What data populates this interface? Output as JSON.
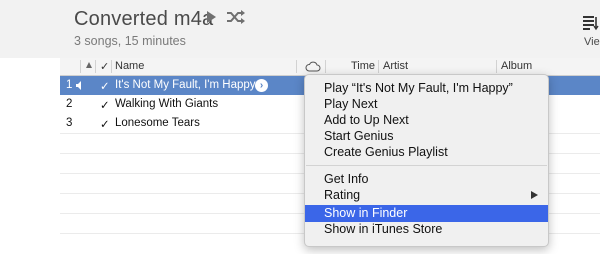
{
  "header": {
    "title": "Converted m4a",
    "subtitle": "3 songs, 15 minutes",
    "view_label": "Vie"
  },
  "table": {
    "columns": {
      "check": "✓",
      "name": "Name",
      "time": "Time",
      "artist": "Artist",
      "album": "Album"
    },
    "rows": [
      {
        "num": "1",
        "check": "✓",
        "name": "It's Not My Fault, I'm Happy",
        "selected": true
      },
      {
        "num": "2",
        "check": "✓",
        "name": "Walking With Giants",
        "selected": false
      },
      {
        "num": "3",
        "check": "✓",
        "name": "Lonesome Tears",
        "selected": false
      }
    ]
  },
  "context_menu": {
    "items": [
      "Play “It's Not My Fault, I'm Happy”",
      "Play Next",
      "Add to Up Next",
      "Start Genius",
      "Create Genius Playlist",
      "Get Info",
      "Rating",
      "Show in Finder",
      "Show in iTunes Store"
    ],
    "highlighted": "Show in Finder"
  },
  "colors": {
    "selection": "#5b86c7",
    "menu_highlight": "#3b66e8"
  },
  "icons": [
    "play-icon",
    "shuffle-icon",
    "view-options-icon",
    "sort-ascending-icon",
    "cloud-icon",
    "speaker-icon",
    "more-options-icon",
    "submenu-arrow-icon"
  ]
}
